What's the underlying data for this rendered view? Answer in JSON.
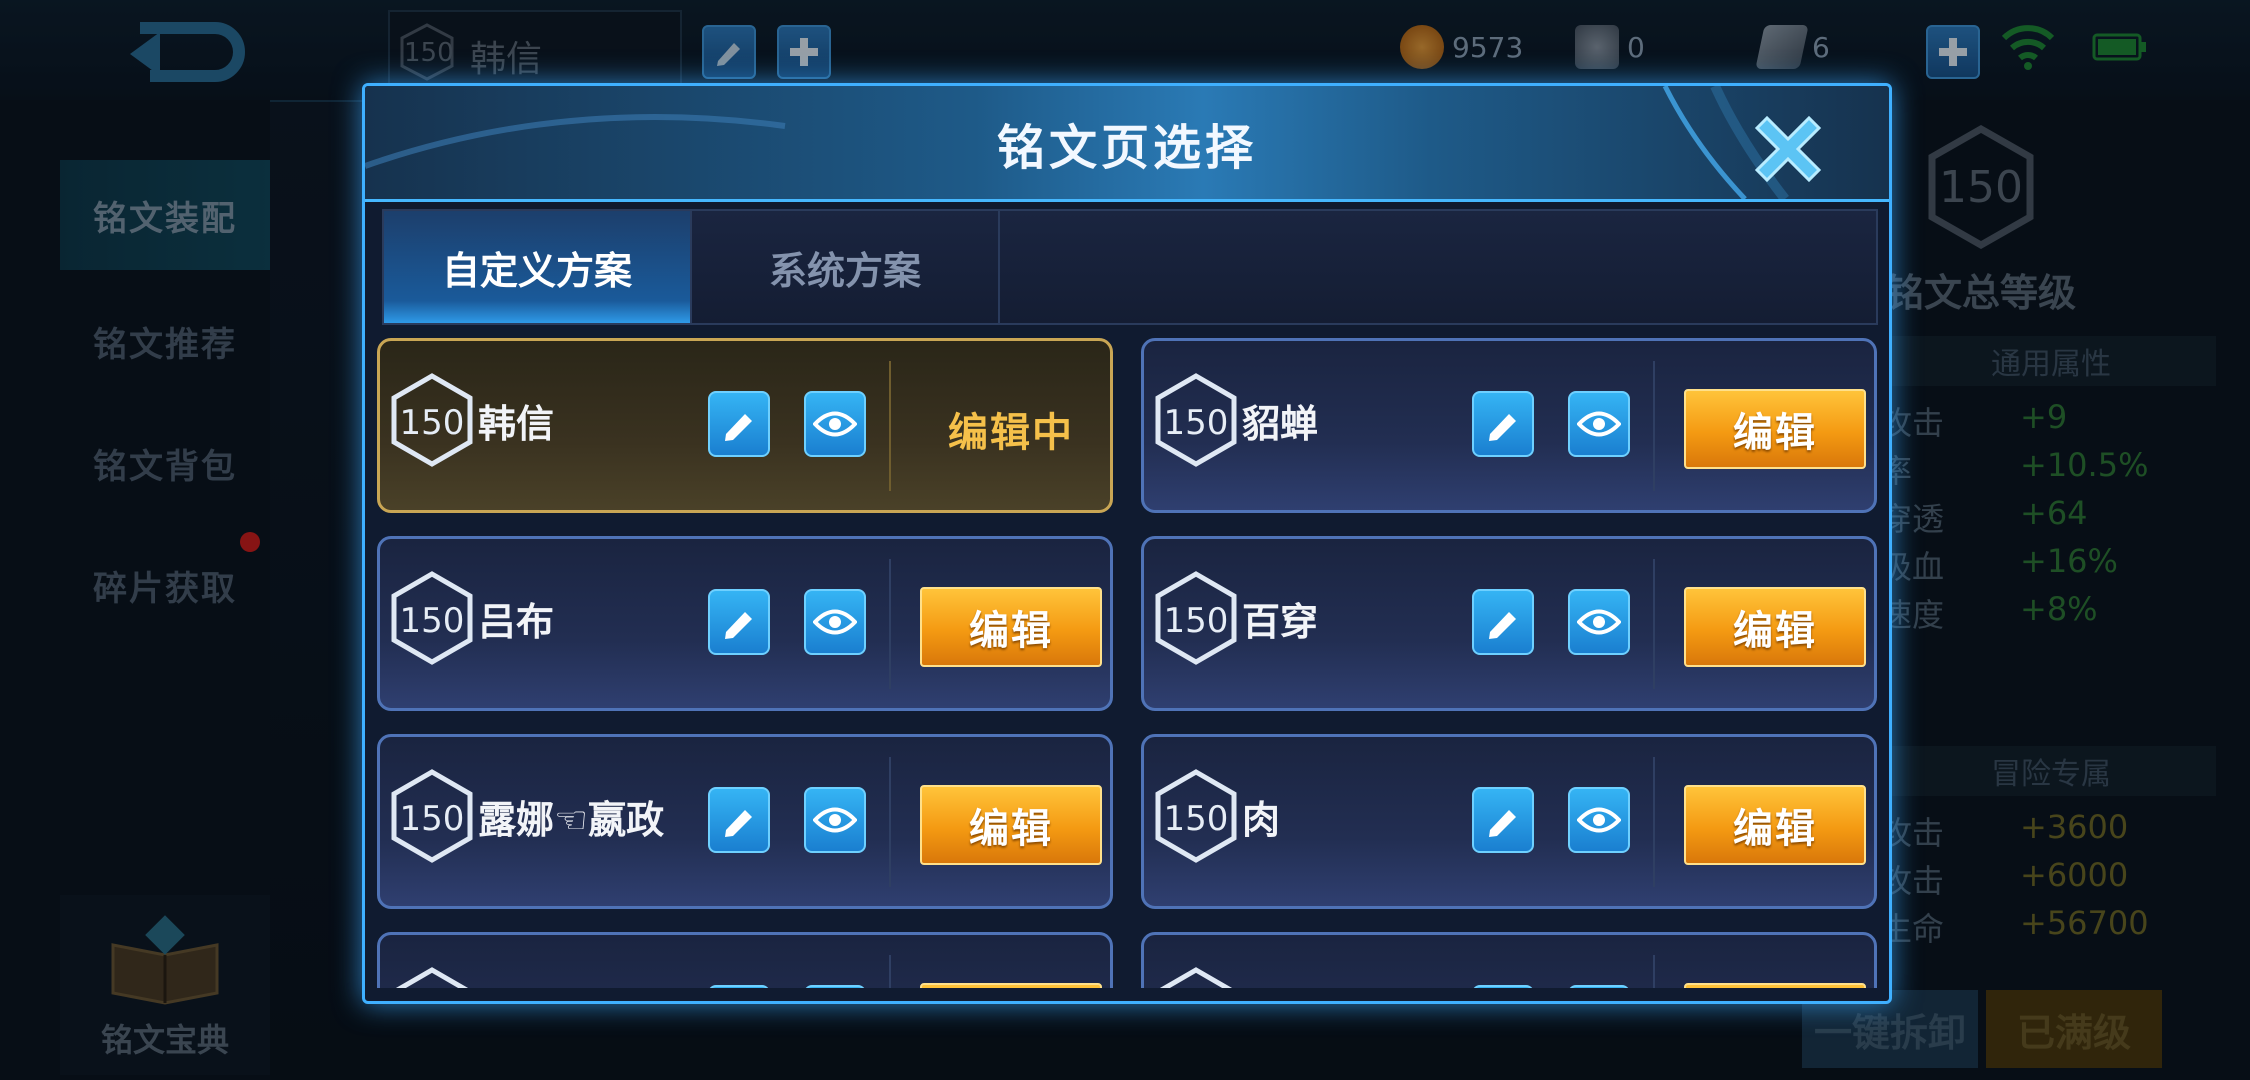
{
  "topbar": {
    "hero_level": "150",
    "hero_name": "韩信",
    "coins": "9573",
    "diamonds": "0",
    "gems": "6"
  },
  "sidebar": {
    "items": [
      {
        "label": "铭文装配"
      },
      {
        "label": "铭文推荐"
      },
      {
        "label": "铭文背包"
      },
      {
        "label": "碎片获取"
      }
    ],
    "book_label": "铭文宝典"
  },
  "right_panel": {
    "level": "150",
    "level_label": "铭文总等级",
    "section1_title": "通用属性",
    "stats1": [
      {
        "name": "攻击",
        "value": "+9"
      },
      {
        "name": "率",
        "value": "+10.5%"
      },
      {
        "name": "穿透",
        "value": "+64"
      },
      {
        "name": "吸血",
        "value": "+16%"
      },
      {
        "name": "速度",
        "value": "+8%"
      }
    ],
    "section2_title": "冒险专属",
    "stats2": [
      {
        "name": "攻击",
        "value": "+3600"
      },
      {
        "name": "攻击",
        "value": "+6000"
      },
      {
        "name": "生命",
        "value": "+56700"
      }
    ],
    "btn_unload": "一键拆卸",
    "btn_maxed": "已满级"
  },
  "dialog": {
    "title": "铭文页选择",
    "tabs": [
      {
        "label": "自定义方案"
      },
      {
        "label": "系统方案"
      }
    ],
    "edit_label": "编辑",
    "editing_label": "编辑中",
    "pages": [
      {
        "level": "150",
        "name": "韩信"
      },
      {
        "level": "150",
        "name": "貂蝉"
      },
      {
        "level": "150",
        "name": "吕布"
      },
      {
        "level": "150",
        "name": "百穿"
      },
      {
        "level": "150",
        "name": "露娜☜嬴政"
      },
      {
        "level": "150",
        "name": "肉"
      }
    ]
  },
  "colors": {
    "accent_blue": "#3fb0ff",
    "edit_orange": "#f49a12",
    "editing_gold": "#f5c04a",
    "stat_green": "#2f7a3a"
  }
}
